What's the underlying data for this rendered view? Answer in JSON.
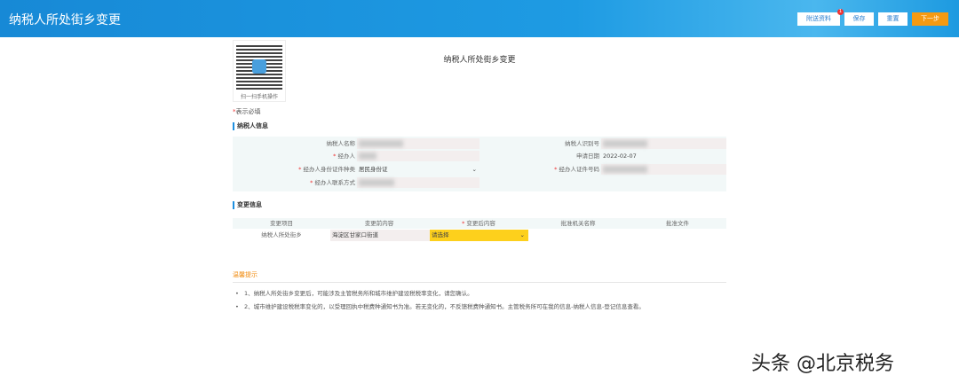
{
  "header": {
    "title": "纳税人所处街乡变更",
    "buttons": {
      "attachments": "附送资料",
      "attachments_badge": "1",
      "save": "保存",
      "reset": "重置",
      "next": "下一步"
    }
  },
  "qr": {
    "caption": "扫一扫手机操作"
  },
  "page_title": "纳税人所处街乡变更",
  "required_note": {
    "star": "*",
    "text": "表示必填"
  },
  "taxpayer_section": {
    "title": "纳税人信息",
    "fields": {
      "name_label": "纳税人名称",
      "id_label": "纳税人识别号",
      "agent_label": "经办人",
      "date_label": "申请日期",
      "date_value": "2022-02-07",
      "idtype_label": "经办人身份证件种类",
      "idtype_value": "居民身份证",
      "idno_label": "经办人证件号码",
      "contact_label": "经办人联系方式"
    }
  },
  "change_section": {
    "title": "变更信息",
    "headers": [
      "变更项目",
      "变更前内容",
      "变更后内容",
      "批准机关名称",
      "批准文件"
    ],
    "row": {
      "item": "纳税人所处街乡",
      "before": "海淀区甘家口街道",
      "after": "请选择"
    }
  },
  "tips": {
    "title": "温馨提示",
    "items": [
      "1、纳税人所处街乡变更后，可能涉及主管税务所和城市维护建设税税率变化，请您确认。",
      "2、城市维护建设税税率变化的，以受理回执中税费种通知书为准。若无变化的，不反馈税费种通知书。主管税务所可在我的信息-纳税人信息-登记信息查看。"
    ]
  },
  "watermark": "头条 @北京税务",
  "colors": {
    "header": "#1e9be3",
    "next": "#f59a12",
    "select": "#fdd01c"
  }
}
